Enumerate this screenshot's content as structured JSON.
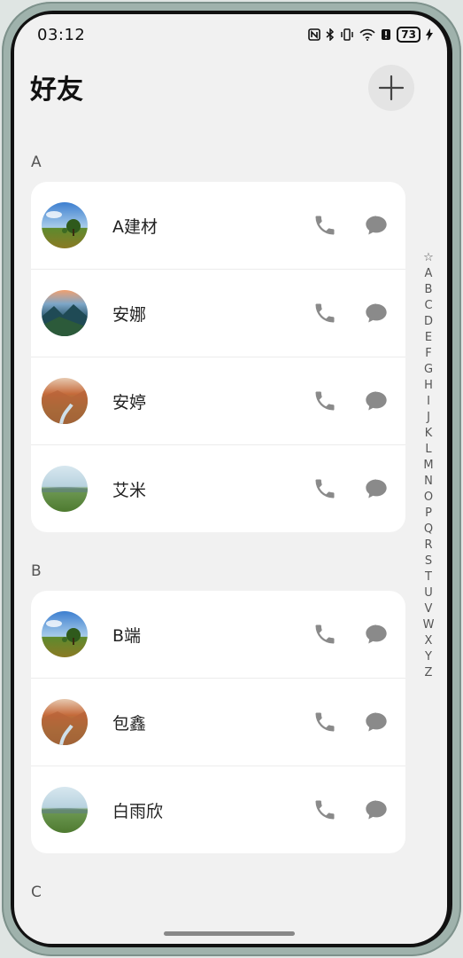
{
  "status": {
    "time": "03:12",
    "battery": "73"
  },
  "header": {
    "title": "好友"
  },
  "sections": [
    {
      "letter": "A",
      "contacts": [
        {
          "name": "A建材",
          "avatar": "tree-field-avatar"
        },
        {
          "name": "安娜",
          "avatar": "mountain-valley-avatar"
        },
        {
          "name": "安婷",
          "avatar": "autumn-stream-avatar"
        },
        {
          "name": "艾米",
          "avatar": "green-meadow-avatar"
        }
      ]
    },
    {
      "letter": "B",
      "contacts": [
        {
          "name": "B端",
          "avatar": "tree-field-avatar"
        },
        {
          "name": "包鑫",
          "avatar": "autumn-stream-avatar"
        },
        {
          "name": "白雨欣",
          "avatar": "green-meadow-avatar"
        }
      ]
    },
    {
      "letter": "C",
      "contacts": []
    }
  ],
  "index_bar": [
    "☆",
    "A",
    "B",
    "C",
    "D",
    "E",
    "F",
    "G",
    "H",
    "I",
    "J",
    "K",
    "L",
    "M",
    "N",
    "O",
    "P",
    "Q",
    "R",
    "S",
    "T",
    "U",
    "V",
    "W",
    "X",
    "Y",
    "Z"
  ],
  "icons": {
    "add": "plus-icon",
    "call": "phone-icon",
    "message": "message-bubble-icon"
  },
  "colors": {
    "background": "#f1f1f1",
    "card": "#ffffff",
    "icon_gray": "#8a8a8a"
  }
}
